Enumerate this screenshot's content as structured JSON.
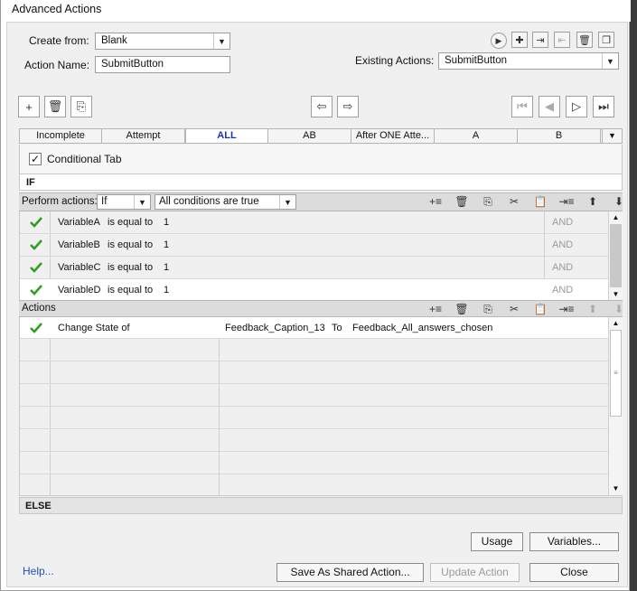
{
  "window": {
    "title": "Advanced Actions"
  },
  "form": {
    "create_from_label": "Create from:",
    "create_from_value": "Blank",
    "action_name_label": "Action Name:",
    "action_name_value": "SubmitButton",
    "existing_actions_label": "Existing Actions:",
    "existing_actions_value": "SubmitButton"
  },
  "tabs": [
    {
      "label": "Incomplete"
    },
    {
      "label": "Attempt"
    },
    {
      "label": "ALL"
    },
    {
      "label": "AB"
    },
    {
      "label": "After ONE Atte..."
    },
    {
      "label": "A"
    },
    {
      "label": "B"
    }
  ],
  "conditional_tab_label": "Conditional Tab",
  "if_label": "IF",
  "perform": {
    "label": "Perform actions:",
    "mode_value": "If",
    "conditions_value": "All conditions are true"
  },
  "conditions": [
    {
      "variable": "VariableA",
      "operator": "is equal to",
      "value": "1",
      "join": "AND"
    },
    {
      "variable": "VariableB",
      "operator": "is equal to",
      "value": "1",
      "join": "AND"
    },
    {
      "variable": "VariableC",
      "operator": "is equal to",
      "value": "1",
      "join": "AND"
    },
    {
      "variable": "VariableD",
      "operator": "is equal to",
      "value": "1",
      "join": "AND"
    }
  ],
  "actions_label": "Actions",
  "actions": [
    {
      "command": "Change State of",
      "target": "Feedback_Caption_13",
      "to_label": "To",
      "state": "Feedback_All_answers_chosen"
    }
  ],
  "else_label": "ELSE",
  "buttons": {
    "usage": "Usage",
    "variables": "Variables...",
    "help": "Help...",
    "save_shared": "Save As Shared Action...",
    "update": "Update Action",
    "close": "Close"
  },
  "colors": {
    "check": "#2e9e1e",
    "help_link": "#1d4fb8",
    "active_tab": "#1a2fc0"
  }
}
